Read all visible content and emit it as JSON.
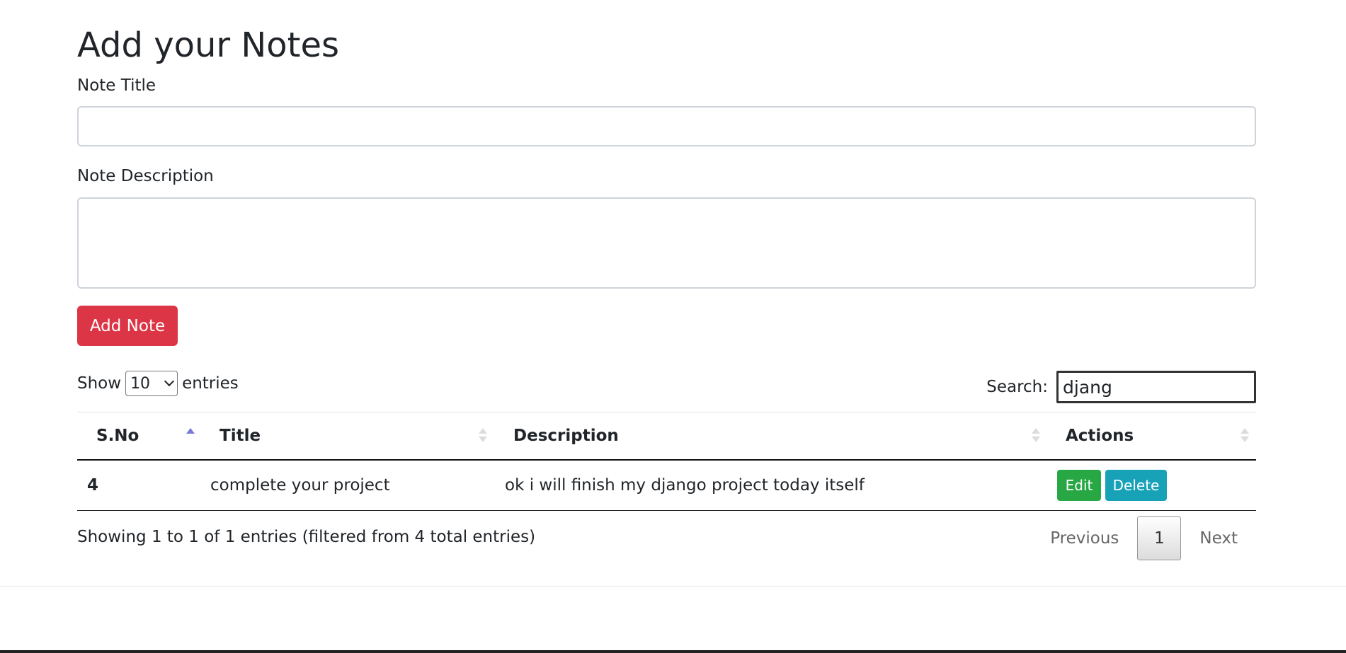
{
  "page": {
    "heading": "Add your Notes"
  },
  "form": {
    "title_label": "Note Title",
    "title_value": "",
    "description_label": "Note Description",
    "description_value": "",
    "submit_label": "Add Note"
  },
  "table_controls": {
    "show_label": "Show",
    "entries_label": "entries",
    "page_length": "10",
    "search_label": "Search:",
    "search_value": "djang"
  },
  "table": {
    "columns": [
      "S.No",
      "Title",
      "Description",
      "Actions"
    ],
    "sorted_column": "S.No",
    "rows": [
      {
        "sno": "4",
        "title": "complete your project",
        "description": "ok i will finish my django project today itself",
        "edit_label": "Edit",
        "delete_label": "Delete"
      }
    ]
  },
  "footer": {
    "info": "Showing 1 to 1 of 1 entries (filtered from 4 total entries)",
    "previous_label": "Previous",
    "current_page": "1",
    "next_label": "Next"
  },
  "colors": {
    "add_button": "#dc3545",
    "edit_button": "#28a745",
    "delete_button": "#17a2b8",
    "sort_active": "#7a7ad6"
  },
  "icons": {
    "sort": "sort-arrows-icon",
    "sort_active": "sort-ascending-icon",
    "select_chevron": "chevron-down-icon",
    "resize": "resize-grip-icon"
  }
}
